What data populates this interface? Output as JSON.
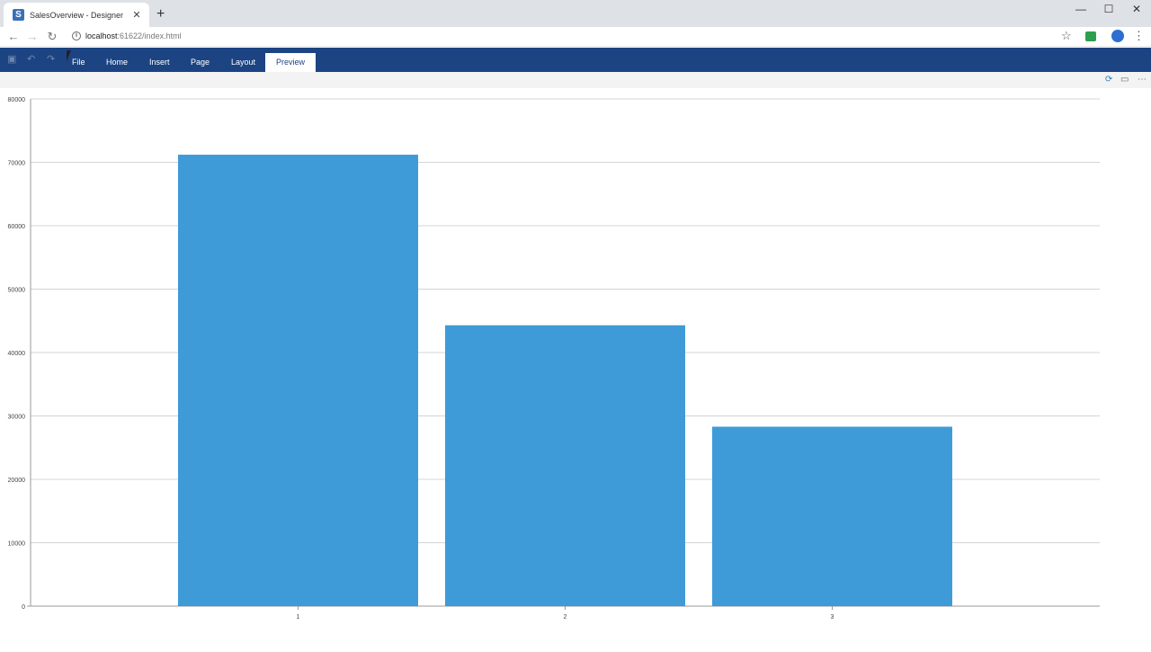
{
  "browser": {
    "tab_title": "SalesOverview - Designer",
    "favicon_letter": "S",
    "close_glyph": "✕",
    "newtab_glyph": "+",
    "url_host": "localhost",
    "url_path": ":61622/index.html",
    "window_controls": {
      "minimize": "—",
      "maximize": "☐",
      "close": "✕"
    }
  },
  "ribbon": {
    "tabs": [
      {
        "label": "File"
      },
      {
        "label": "Home"
      },
      {
        "label": "Insert"
      },
      {
        "label": "Page"
      },
      {
        "label": "Layout"
      },
      {
        "label": "Preview",
        "active": true
      }
    ]
  },
  "icons": {
    "save": "save-icon",
    "undo": "undo-icon",
    "redo": "redo-icon",
    "refresh": "refresh-icon",
    "open": "open-folder-icon",
    "more": "more-icon"
  },
  "colors": {
    "ribbon": "#1c4483",
    "bar": "#3e9bd8",
    "grid": "#d4d4d4",
    "axis": "#9a9a9a"
  },
  "chart_data": {
    "type": "bar",
    "categories": [
      "1",
      "2",
      "3"
    ],
    "values": [
      71200,
      44300,
      28300
    ],
    "ylim": [
      0,
      80000
    ],
    "yticks": [
      0,
      10000,
      20000,
      30000,
      40000,
      50000,
      60000,
      70000,
      80000
    ],
    "grid": true,
    "xlabel": "",
    "ylabel": "",
    "title": ""
  }
}
